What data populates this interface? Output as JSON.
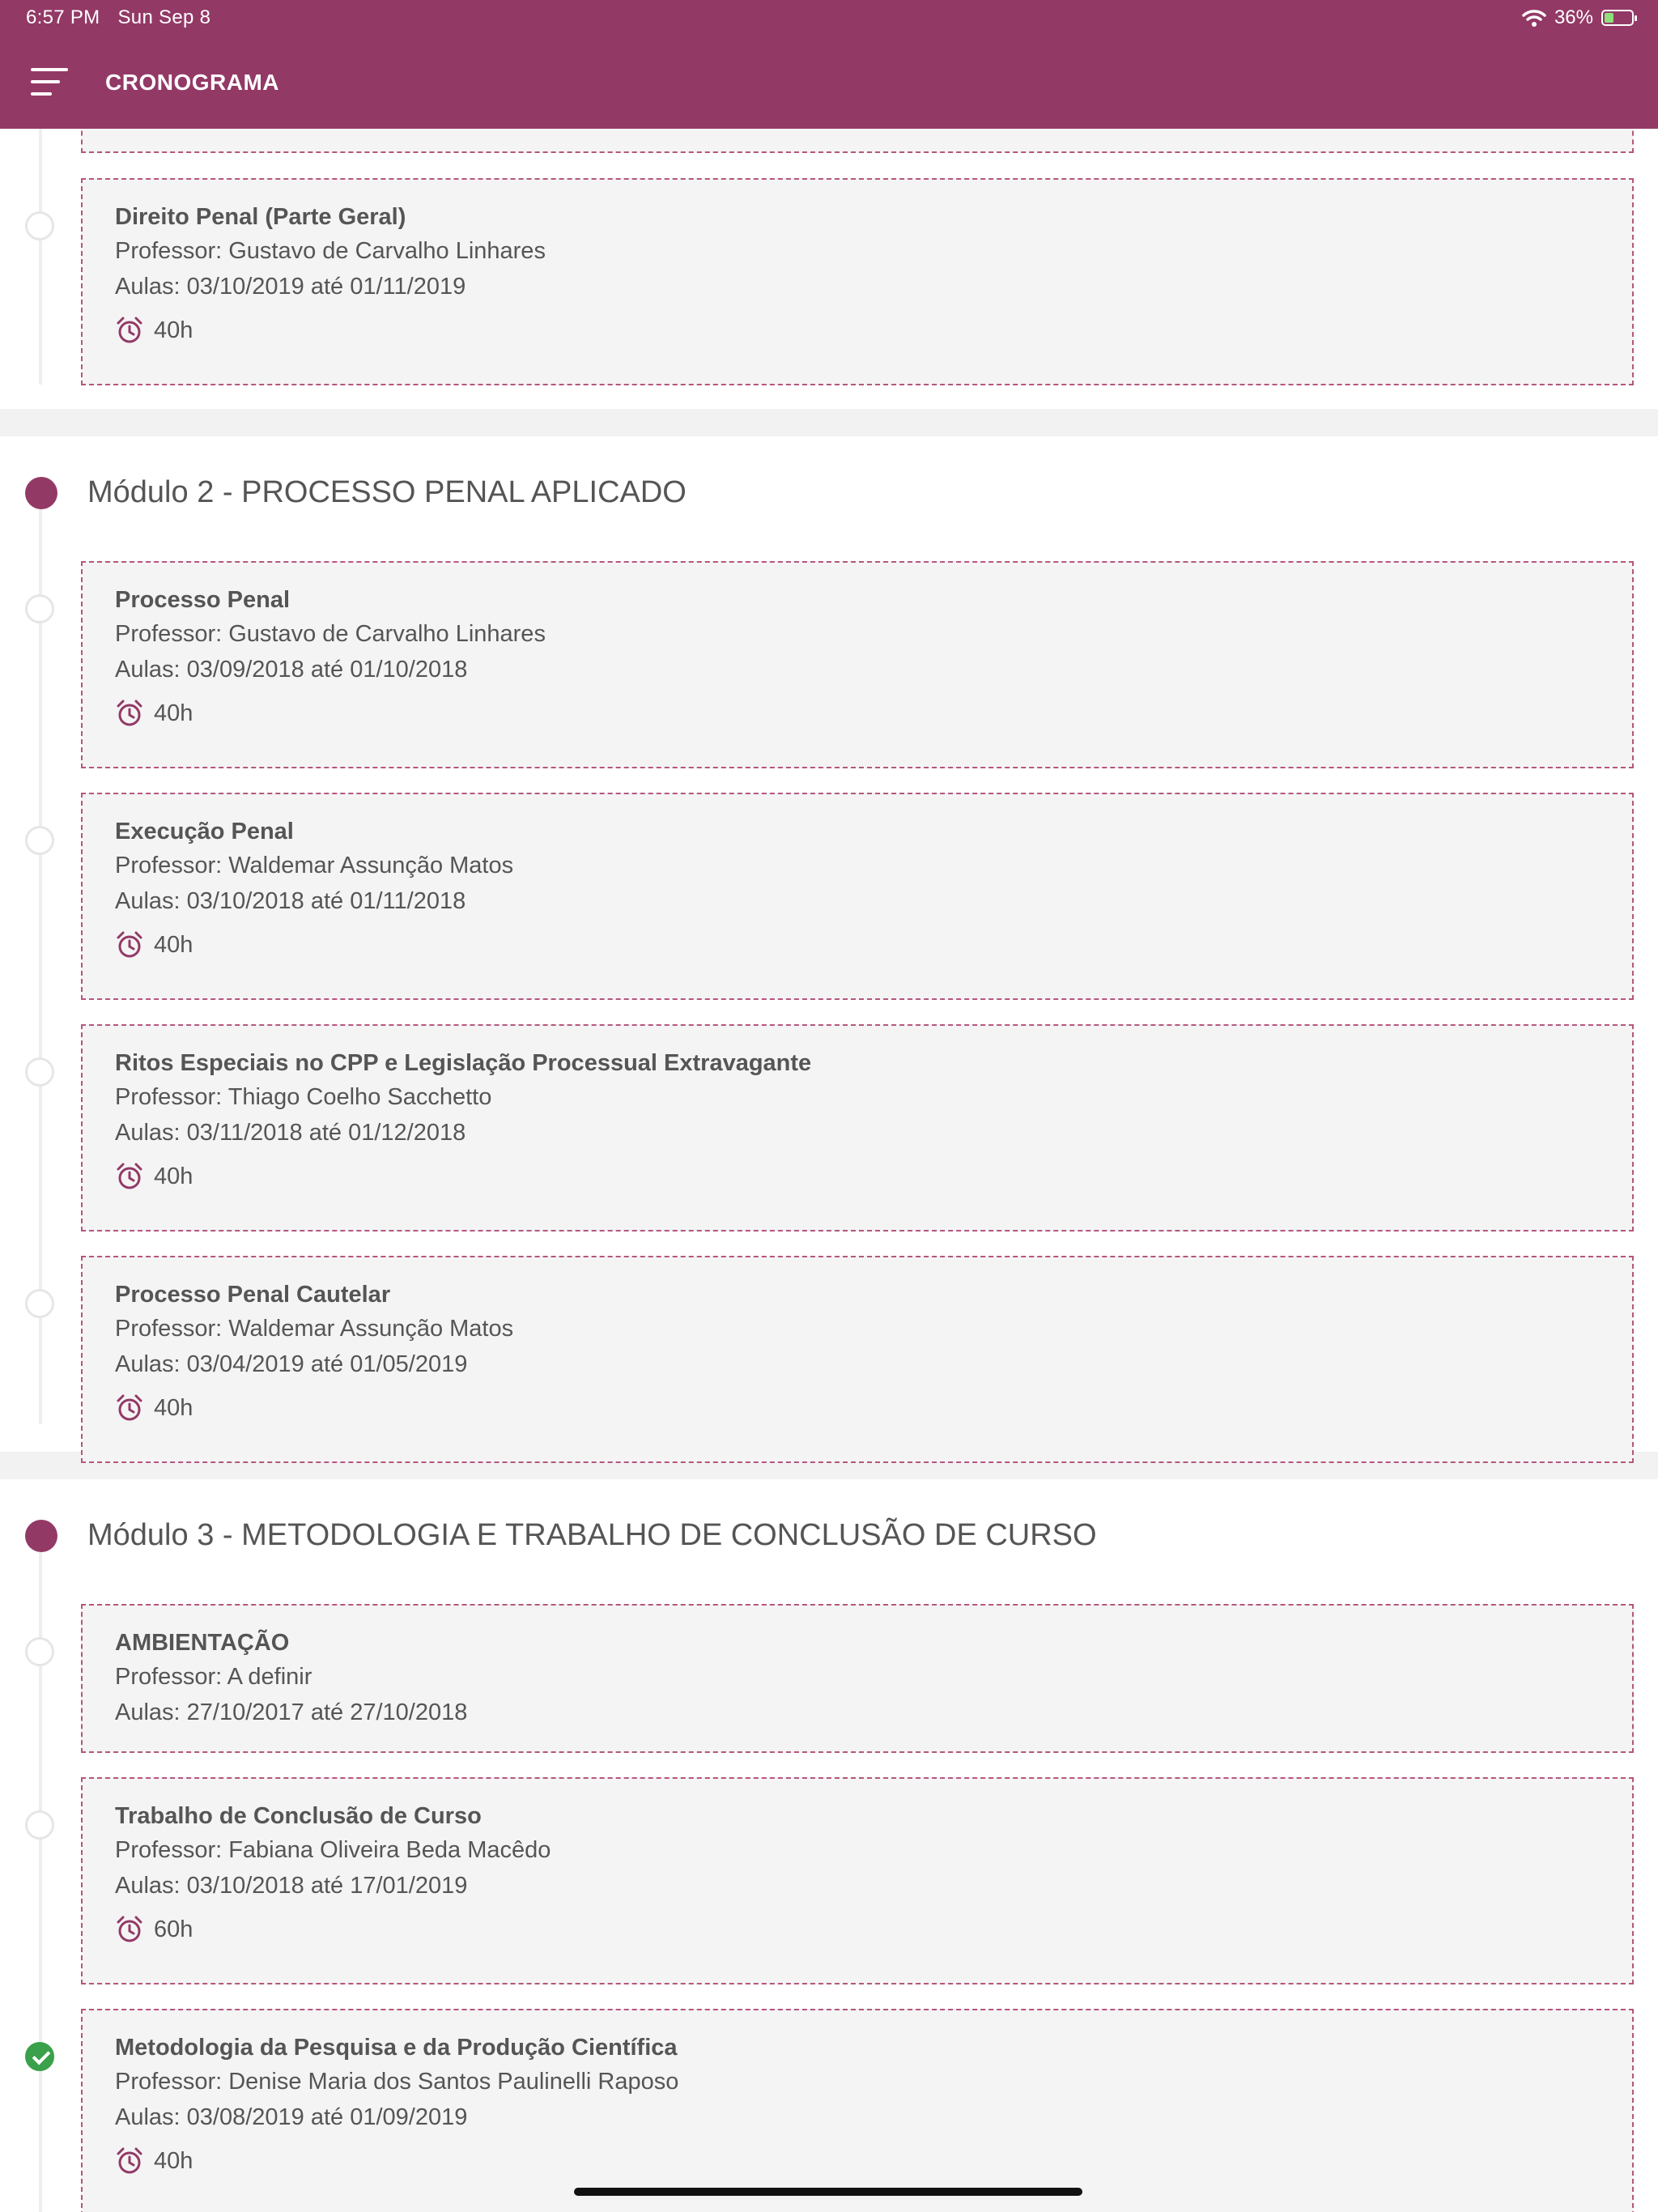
{
  "status_bar": {
    "time": "6:57 PM",
    "date": "Sun Sep 8",
    "battery": "36%"
  },
  "header": {
    "title": "CRONOGRAMA",
    "menu_icon": "hamburger-menu-icon"
  },
  "colors": {
    "brand": "#933966",
    "card_border": "#b5567e",
    "card_bg": "#f4f4f4",
    "done": "#3aa04a"
  },
  "top_item": {
    "title": "Direito Penal (Parte Geral)",
    "professor": "Professor: Gustavo de Carvalho Linhares",
    "aulas": "Aulas: 03/10/2019 até 01/11/2019",
    "hours": "40h"
  },
  "modules": [
    {
      "title": "Módulo 2 - PROCESSO PENAL APLICADO",
      "items": [
        {
          "title": "Processo Penal",
          "professor": "Professor: Gustavo de Carvalho Linhares",
          "aulas": "Aulas: 03/09/2018 até 01/10/2018",
          "hours": "40h"
        },
        {
          "title": "Execução Penal",
          "professor": "Professor: Waldemar Assunção Matos",
          "aulas": "Aulas: 03/10/2018 até 01/11/2018",
          "hours": "40h"
        },
        {
          "title": "Ritos Especiais no CPP e Legislação Processual Extravagante",
          "professor": "Professor: Thiago Coelho Sacchetto",
          "aulas": "Aulas: 03/11/2018 até 01/12/2018",
          "hours": "40h"
        },
        {
          "title": "Processo Penal Cautelar",
          "professor": "Professor: Waldemar Assunção Matos",
          "aulas": "Aulas: 03/04/2019 até 01/05/2019",
          "hours": "40h"
        }
      ]
    },
    {
      "title": "Módulo 3 - METODOLOGIA E TRABALHO DE CONCLUSÃO DE CURSO",
      "items": [
        {
          "title": "AMBIENTAÇÃO",
          "professor": "Professor: A definir",
          "aulas": "Aulas: 27/10/2017 até 27/10/2018"
        },
        {
          "title": "Trabalho de Conclusão de Curso",
          "professor": "Professor: Fabiana Oliveira Beda Macêdo",
          "aulas": "Aulas: 03/10/2018 até 17/01/2019",
          "hours": "60h"
        },
        {
          "title": "Metodologia da Pesquisa e da Produção Científica",
          "professor": "Professor: Denise Maria dos Santos Paulinelli Raposo",
          "aulas": "Aulas: 03/08/2019 até 01/09/2019",
          "hours": "40h",
          "completed": true
        }
      ]
    }
  ]
}
